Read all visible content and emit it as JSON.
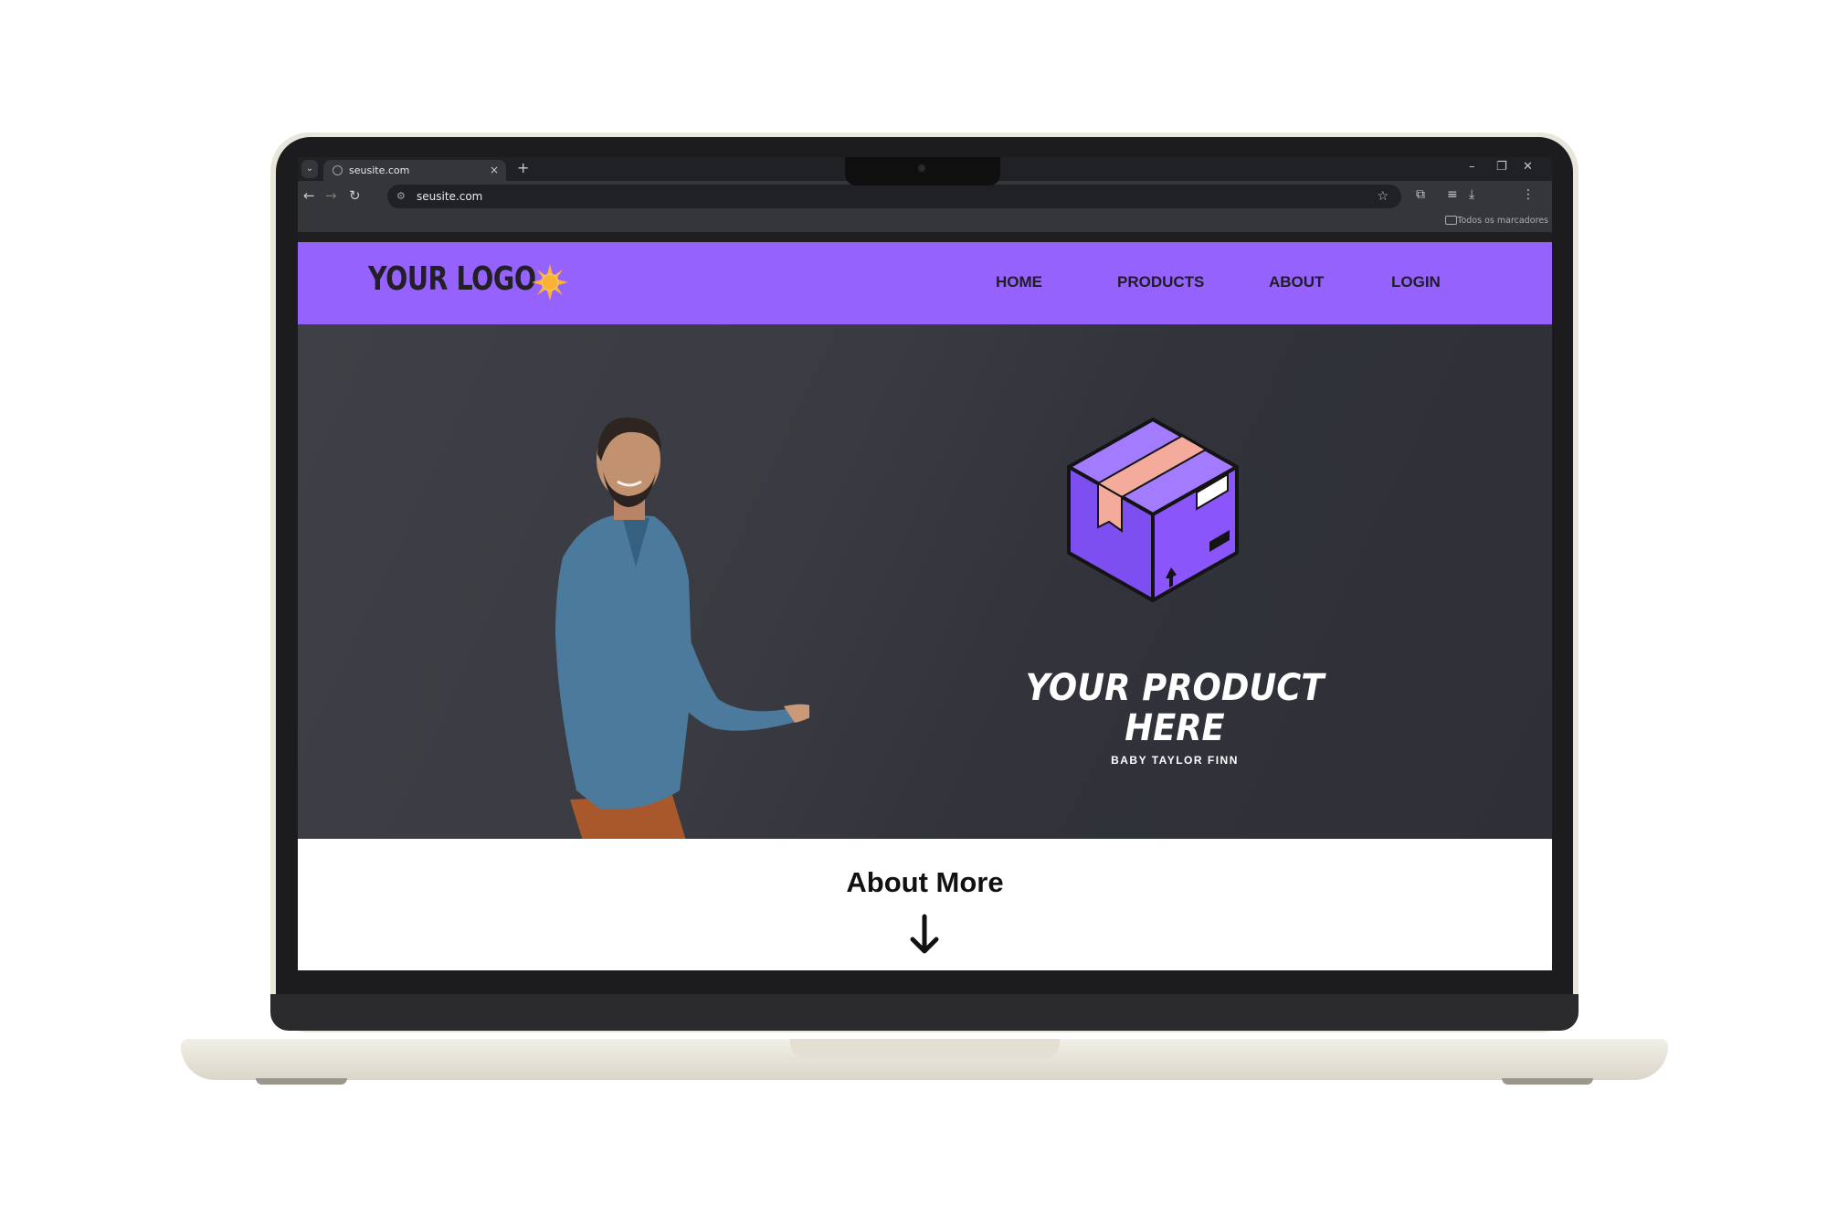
{
  "browser": {
    "tab_title": "seusite.com",
    "tab_close": "×",
    "new_tab": "+",
    "url": "seusite.com",
    "bookmarks_label": "Todos os marcadores",
    "window_controls": [
      "–",
      "❐",
      "✕"
    ],
    "icons": [
      "back-icon",
      "forward-icon",
      "reload-icon",
      "site-settings-icon",
      "bookmark-star-icon",
      "extensions-icon",
      "media-control-icon",
      "download-icon",
      "menu-icon"
    ]
  },
  "site": {
    "logo": "YOUR LOGO",
    "nav": [
      {
        "label": "HOME"
      },
      {
        "label": "PRODUCTS"
      },
      {
        "label": "ABOUT"
      },
      {
        "label": "LOGIN"
      }
    ],
    "colors": {
      "nav_bg": "#9562fd",
      "hero_bg": "#3a3b42",
      "box_purple": "#8a55fb",
      "tape": "#f5ab9c",
      "sun": "#f9b233"
    }
  },
  "hero": {
    "product_title_line1": "YOUR PRODUCT",
    "product_title_line2": "HERE",
    "product_subtitle": "BABY TAYLOR FINN"
  },
  "about": {
    "title": "About More",
    "arrow_icon": "arrow-down-icon"
  }
}
